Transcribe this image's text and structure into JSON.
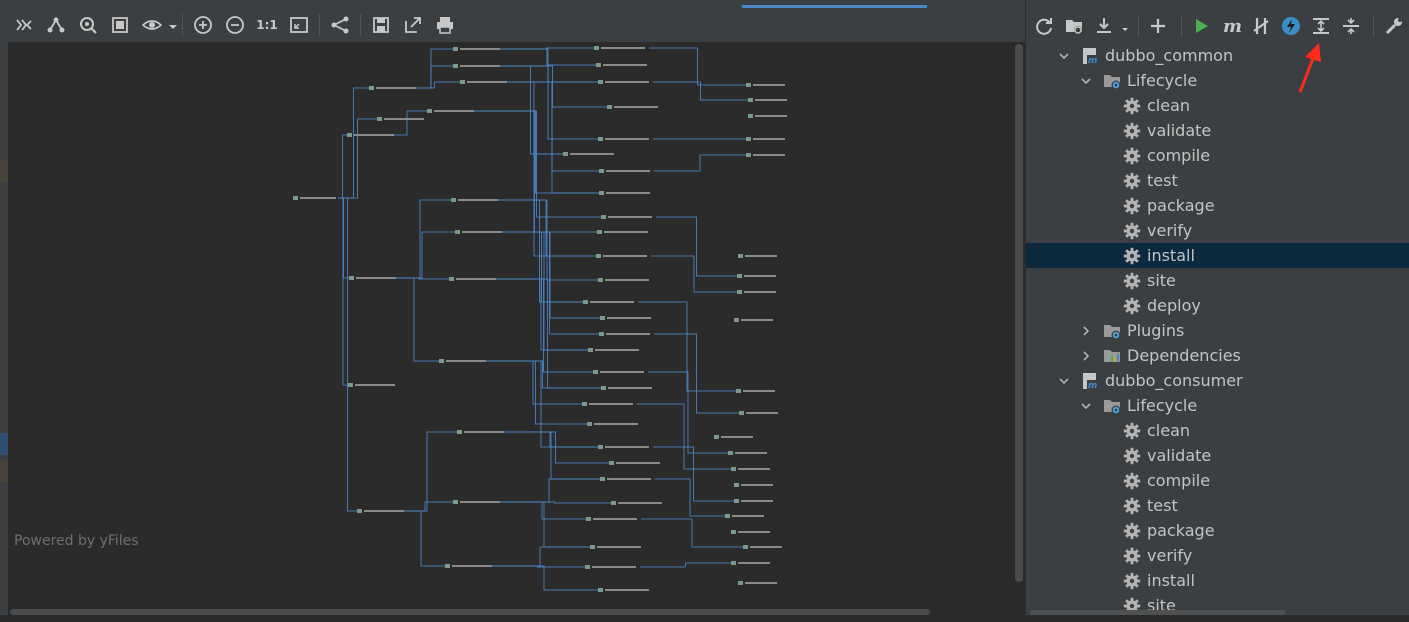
{
  "diagram": {
    "toolbar_icons": [
      "collapse-icon",
      "hierarchy-layout-icon",
      "find-icon",
      "fit-content-icon",
      "preview-icon",
      "zoom-in-icon",
      "zoom-out-icon",
      "actual-size-label",
      "fit-page-icon",
      "graph-layout-icon",
      "save-icon",
      "export-icon",
      "print-icon"
    ],
    "actual_size_label": "1:1",
    "powered_by": "Powered by yFiles",
    "root_node": "dubbo_consumer"
  },
  "maven": {
    "toolbar_icons": [
      "reload-icon",
      "add-folder-icon",
      "download-icon",
      "plus-icon",
      "run-icon",
      "maven-m-icon",
      "toggle-skip-tests-icon",
      "lightning-icon",
      "expand-all-icon",
      "collapse-all-icon",
      "wrench-icon"
    ],
    "tree": [
      {
        "label": "dubbo_common",
        "level": 0,
        "kind": "project",
        "arrow": "down"
      },
      {
        "label": "Lifecycle",
        "level": 1,
        "kind": "folder",
        "arrow": "down"
      },
      {
        "label": "clean",
        "level": 2,
        "kind": "goal"
      },
      {
        "label": "validate",
        "level": 2,
        "kind": "goal"
      },
      {
        "label": "compile",
        "level": 2,
        "kind": "goal"
      },
      {
        "label": "test",
        "level": 2,
        "kind": "goal"
      },
      {
        "label": "package",
        "level": 2,
        "kind": "goal"
      },
      {
        "label": "verify",
        "level": 2,
        "kind": "goal"
      },
      {
        "label": "install",
        "level": 2,
        "kind": "goal",
        "selected": true
      },
      {
        "label": "site",
        "level": 2,
        "kind": "goal"
      },
      {
        "label": "deploy",
        "level": 2,
        "kind": "goal"
      },
      {
        "label": "Plugins",
        "level": 1,
        "kind": "folder",
        "arrow": "right"
      },
      {
        "label": "Dependencies",
        "level": 1,
        "kind": "deps",
        "arrow": "right"
      },
      {
        "label": "dubbo_consumer",
        "level": 0,
        "kind": "project",
        "arrow": "down"
      },
      {
        "label": "Lifecycle",
        "level": 1,
        "kind": "folder",
        "arrow": "down"
      },
      {
        "label": "clean",
        "level": 2,
        "kind": "goal"
      },
      {
        "label": "validate",
        "level": 2,
        "kind": "goal"
      },
      {
        "label": "compile",
        "level": 2,
        "kind": "goal"
      },
      {
        "label": "test",
        "level": 2,
        "kind": "goal"
      },
      {
        "label": "package",
        "level": 2,
        "kind": "goal"
      },
      {
        "label": "verify",
        "level": 2,
        "kind": "goal"
      },
      {
        "label": "install",
        "level": 2,
        "kind": "goal"
      },
      {
        "label": "site",
        "level": 2,
        "kind": "goal"
      }
    ]
  },
  "colors": {
    "accent_selection": "#0d293e",
    "edge_blue": "#4a88c7",
    "annotation_red": "#ff2a1a",
    "run_green": "#4caf50"
  }
}
